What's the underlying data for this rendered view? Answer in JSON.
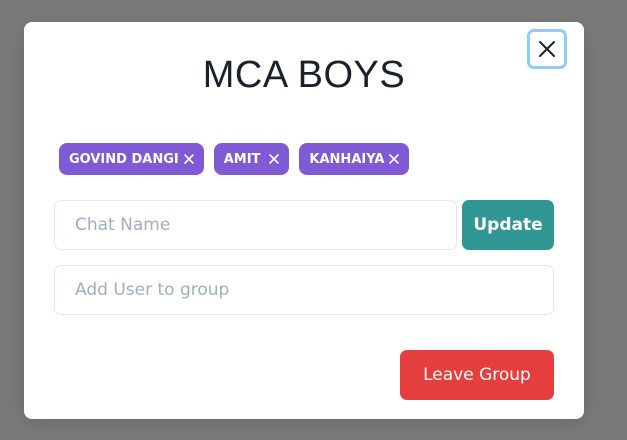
{
  "modal": {
    "title": "MCA BOYS",
    "close_icon": "close-icon"
  },
  "members": [
    {
      "label": "GOVIND DANGI",
      "remove_icon": "close-icon"
    },
    {
      "label": "AMIT",
      "remove_icon": "close-icon"
    },
    {
      "label": "KANHAIYA",
      "remove_icon": "close-icon"
    }
  ],
  "form": {
    "chat_name_placeholder": "Chat Name",
    "chat_name_value": "",
    "update_label": "Update",
    "add_user_placeholder": "Add User to group",
    "add_user_value": ""
  },
  "footer": {
    "leave_label": "Leave Group"
  },
  "colors": {
    "overlay": "#7a7a7a",
    "tag": "#805ad5",
    "update": "#319795",
    "leave": "#e53e3e",
    "focus_ring": "#90cdf4"
  }
}
